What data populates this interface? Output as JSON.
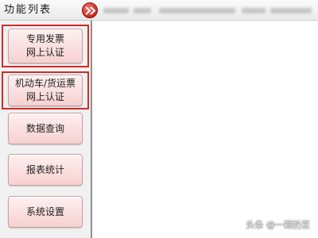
{
  "header": {
    "title": "功能列表"
  },
  "sidebar": {
    "buttons": [
      {
        "line1": "专用发票",
        "line2": "网上认证"
      },
      {
        "line1": "机动车/货运票",
        "line2": "网上认证"
      },
      {
        "line1": "数据查询"
      },
      {
        "line1": "报表统计"
      },
      {
        "line1": "系统设置"
      }
    ]
  },
  "watermark": {
    "text": "头条 @一颗奶豆"
  },
  "colors": {
    "highlight": "#d32a2a",
    "button": "#f6d1d1",
    "expand": "#c8281e"
  },
  "icons": {
    "expand": "double-chevron-right-icon"
  }
}
